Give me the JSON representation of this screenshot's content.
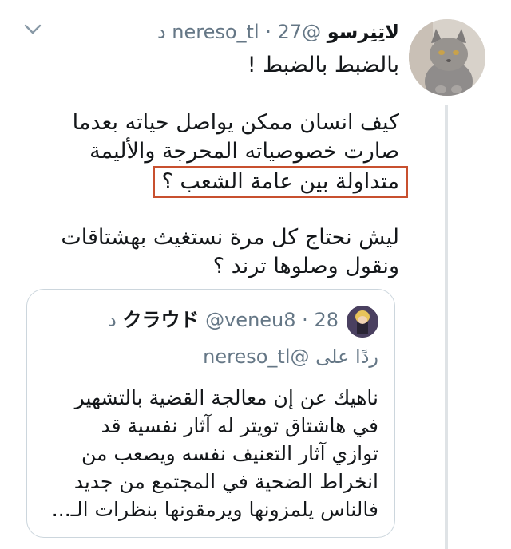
{
  "tweet": {
    "author_name": "لاتِنِرسو",
    "handle": "@nereso_tl",
    "time": "27 د",
    "separator": "·",
    "para1": "بالضبط بالضبط !",
    "para2_line1": "كيف انسان ممكن يواصل حياته بعدما",
    "para2_line2": "صارت خصوصياته المحرجة والأليمة",
    "para2_line3": "متداولة بين عامة الشعب ؟",
    "para3_line1": "ليش نحتاج كل مرة نستغيث بهشتاقات",
    "para3_line2": "ونقول وصلوها ترند ؟"
  },
  "quoted": {
    "author_name": "クラウド",
    "handle": "@veneu8",
    "time": "28 د",
    "separator": "·",
    "reply_label": "ردًا على",
    "reply_handle": "@nereso_tl",
    "lines": [
      "ناهيك عن إن معالجة القضية بالتشهير",
      "في هاشتاق تويتر له آثار نفسية قد",
      "توازي آثار التعنيف نفسه ويصعب من",
      "انخراط الضحية في المجتمع من جديد",
      "فالناس يلمزونها ويرمقونها بنظرات الـ..."
    ]
  },
  "colors": {
    "highlight_border": "#c8502f",
    "secondary_text": "#657786",
    "thread_line": "#dfe3e6"
  },
  "icons": {
    "menu": "chevron-down-icon",
    "avatar": "cat-avatar-icon",
    "quoted_avatar": "character-avatar-icon"
  }
}
